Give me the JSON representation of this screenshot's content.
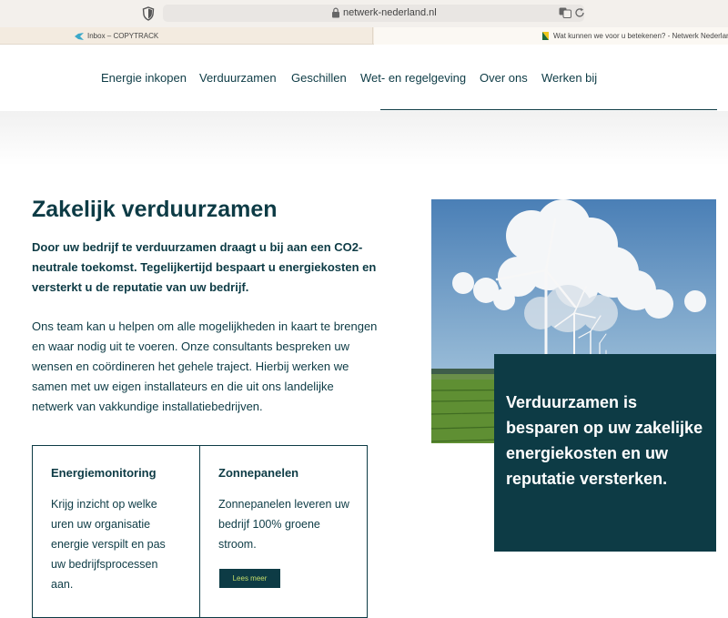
{
  "browser": {
    "url": "netwerk-nederland.nl",
    "tabs": [
      {
        "label": "Inbox – COPYTRACK"
      },
      {
        "label": "Wat kunnen we voor u betekenen? - Netwerk Nederland"
      }
    ]
  },
  "nav": {
    "items": [
      {
        "label": "Energie inkopen"
      },
      {
        "label": "Verduurzamen"
      },
      {
        "label": "Geschillen"
      },
      {
        "label": "Wet- en regelgeving"
      },
      {
        "label": "Over ons"
      },
      {
        "label": "Werken bij"
      }
    ]
  },
  "main": {
    "title": "Zakelijk verduurzamen",
    "lead": "Door uw bedrijf te verduurzamen draagt u bij aan een CO2-neutrale toekomst. Tegelijkertijd bespaart u energiekosten en versterkt u de reputatie van uw bedrijf.",
    "body": "Ons team kan u helpen om alle mogelijkheden in kaart te brengen en waar nodig uit te voeren.  Onze consultants bespreken uw wensen en coördineren het gehele traject.  Hierbij werken we samen met uw eigen installateurs en die uit ons landelijke netwerk van vakkundige installatiebedrijven."
  },
  "cards": [
    {
      "title": "Energiemonitoring",
      "text": "Krijg inzicht op welke uren uw organisatie energie verspilt en pas uw bedrijfsprocessen aan."
    },
    {
      "title": "Zonnepanelen",
      "text": "Zonnepanelen leveren uw bedrijf 100% groene stroom.",
      "button": "Lees meer"
    }
  ],
  "quote": "Verduurzamen is besparen op uw zakelijke energiekosten en uw reputatie versterken.",
  "colors": {
    "primary": "#0d3b45",
    "accent": "#c6df6a",
    "chrome": "#f3f0ec"
  }
}
